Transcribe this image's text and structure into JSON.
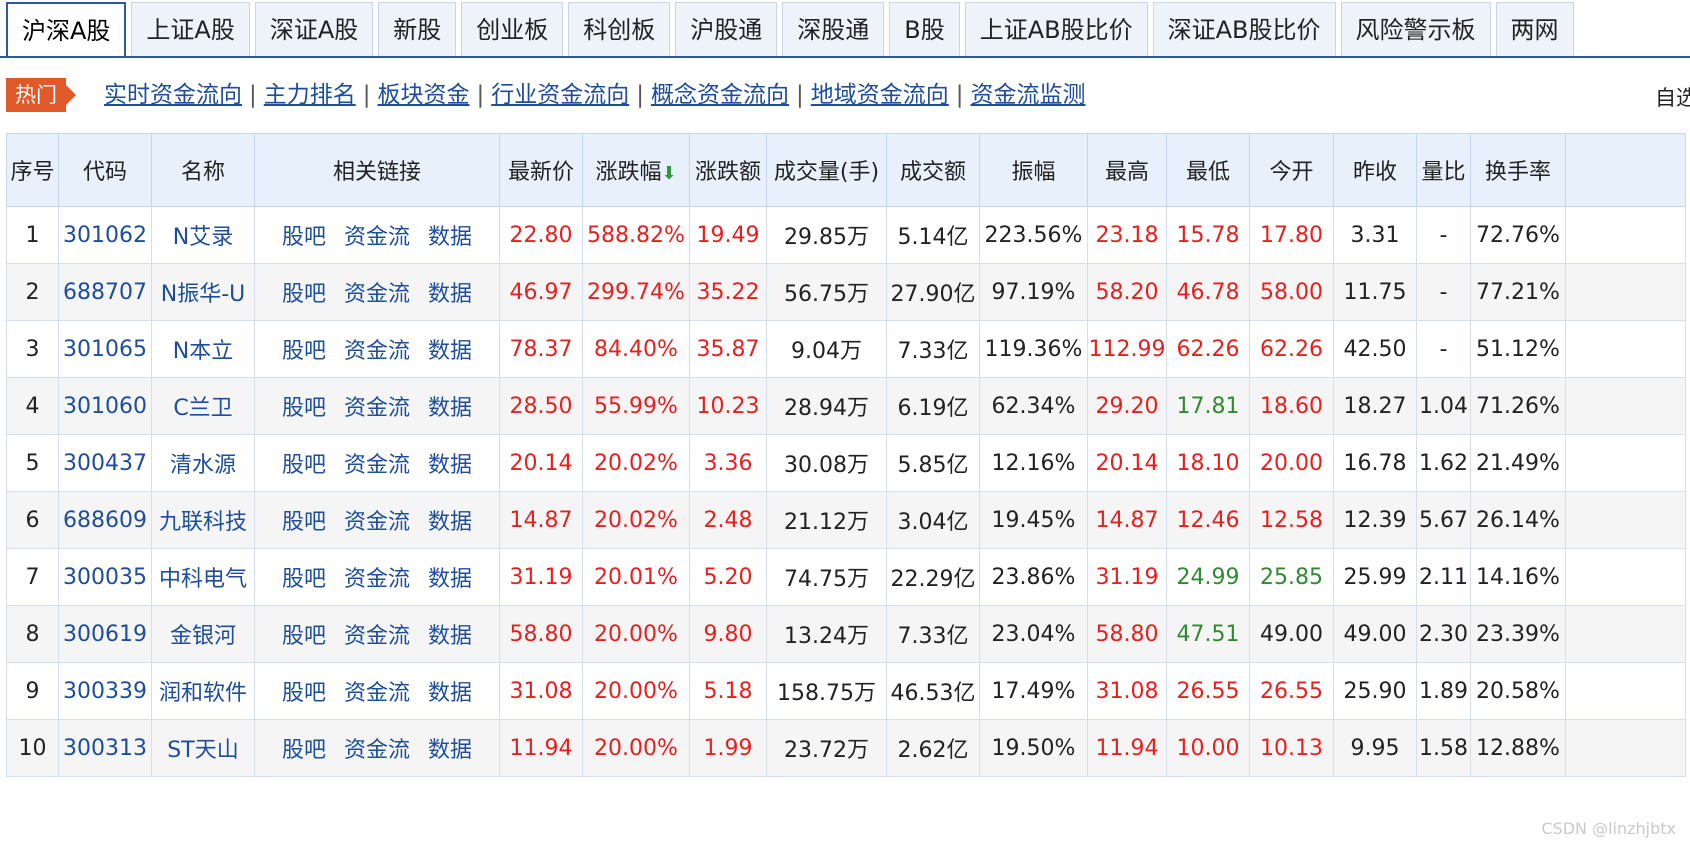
{
  "tabs": [
    {
      "label": "沪深A股",
      "active": true
    },
    {
      "label": "上证A股"
    },
    {
      "label": "深证A股"
    },
    {
      "label": "新股"
    },
    {
      "label": "创业板"
    },
    {
      "label": "科创板"
    },
    {
      "label": "沪股通"
    },
    {
      "label": "深股通"
    },
    {
      "label": "B股"
    },
    {
      "label": "上证AB股比价"
    },
    {
      "label": "深证AB股比价"
    },
    {
      "label": "风险警示板"
    },
    {
      "label": "两网"
    }
  ],
  "hot": {
    "badge": "热门",
    "links": [
      "实时资金流向",
      "主力排名",
      "板块资金",
      "行业资金流向",
      "概念资金流向",
      "地域资金流向",
      "资金流监测"
    ],
    "right_label": "自选"
  },
  "table": {
    "headers": [
      "序号",
      "代码",
      "名称",
      "相关链接",
      "最新价",
      "涨跌幅",
      "涨跌额",
      "成交量(手)",
      "成交额",
      "振幅",
      "最高",
      "最低",
      "今开",
      "昨收",
      "量比",
      "换手率"
    ],
    "sort_arrow": "⬇",
    "link_labels": [
      "股吧",
      "资金流",
      "数据"
    ],
    "rows": [
      [
        "1",
        "301062",
        "N艾录",
        "22.80",
        "588.82%",
        "19.49",
        "29.85万",
        "5.14亿",
        "223.56%",
        "23.18",
        "15.78",
        "17.80",
        "3.31",
        "-",
        "72.76%"
      ],
      [
        "2",
        "688707",
        "N振华-U",
        "46.97",
        "299.74%",
        "35.22",
        "56.75万",
        "27.90亿",
        "97.19%",
        "58.20",
        "46.78",
        "58.00",
        "11.75",
        "-",
        "77.21%"
      ],
      [
        "3",
        "301065",
        "N本立",
        "78.37",
        "84.40%",
        "35.87",
        "9.04万",
        "7.33亿",
        "119.36%",
        "112.99",
        "62.26",
        "62.26",
        "42.50",
        "-",
        "51.12%"
      ],
      [
        "4",
        "301060",
        "C兰卫",
        "28.50",
        "55.99%",
        "10.23",
        "28.94万",
        "6.19亿",
        "62.34%",
        "29.20",
        "17.81",
        "18.60",
        "18.27",
        "1.04",
        "71.26%"
      ],
      [
        "5",
        "300437",
        "清水源",
        "20.14",
        "20.02%",
        "3.36",
        "30.08万",
        "5.85亿",
        "12.16%",
        "20.14",
        "18.10",
        "20.00",
        "16.78",
        "1.62",
        "21.49%"
      ],
      [
        "6",
        "688609",
        "九联科技",
        "14.87",
        "20.02%",
        "2.48",
        "21.12万",
        "3.04亿",
        "19.45%",
        "14.87",
        "12.46",
        "12.58",
        "12.39",
        "5.67",
        "26.14%"
      ],
      [
        "7",
        "300035",
        "中科电气",
        "31.19",
        "20.01%",
        "5.20",
        "74.75万",
        "22.29亿",
        "23.86%",
        "31.19",
        "24.99",
        "25.85",
        "25.99",
        "2.11",
        "14.16%"
      ],
      [
        "8",
        "300619",
        "金银河",
        "58.80",
        "20.00%",
        "9.80",
        "13.24万",
        "7.33亿",
        "23.04%",
        "58.80",
        "47.51",
        "49.00",
        "49.00",
        "2.30",
        "23.39%"
      ],
      [
        "9",
        "300339",
        "润和软件",
        "31.08",
        "20.00%",
        "5.18",
        "158.75万",
        "46.53亿",
        "17.49%",
        "31.08",
        "26.55",
        "26.55",
        "25.90",
        "1.89",
        "20.58%"
      ],
      [
        "10",
        "300313",
        "ST天山",
        "11.94",
        "20.00%",
        "1.99",
        "23.72万",
        "2.62亿",
        "19.50%",
        "11.94",
        "10.00",
        "10.13",
        "9.95",
        "1.58",
        "12.88%"
      ]
    ]
  },
  "colors": {
    "up": "#e6201f",
    "down": "#2f8a2f",
    "neutral": "#222222",
    "link": "#1d4d9b"
  },
  "watermark": "CSDN @linzhjbtx"
}
